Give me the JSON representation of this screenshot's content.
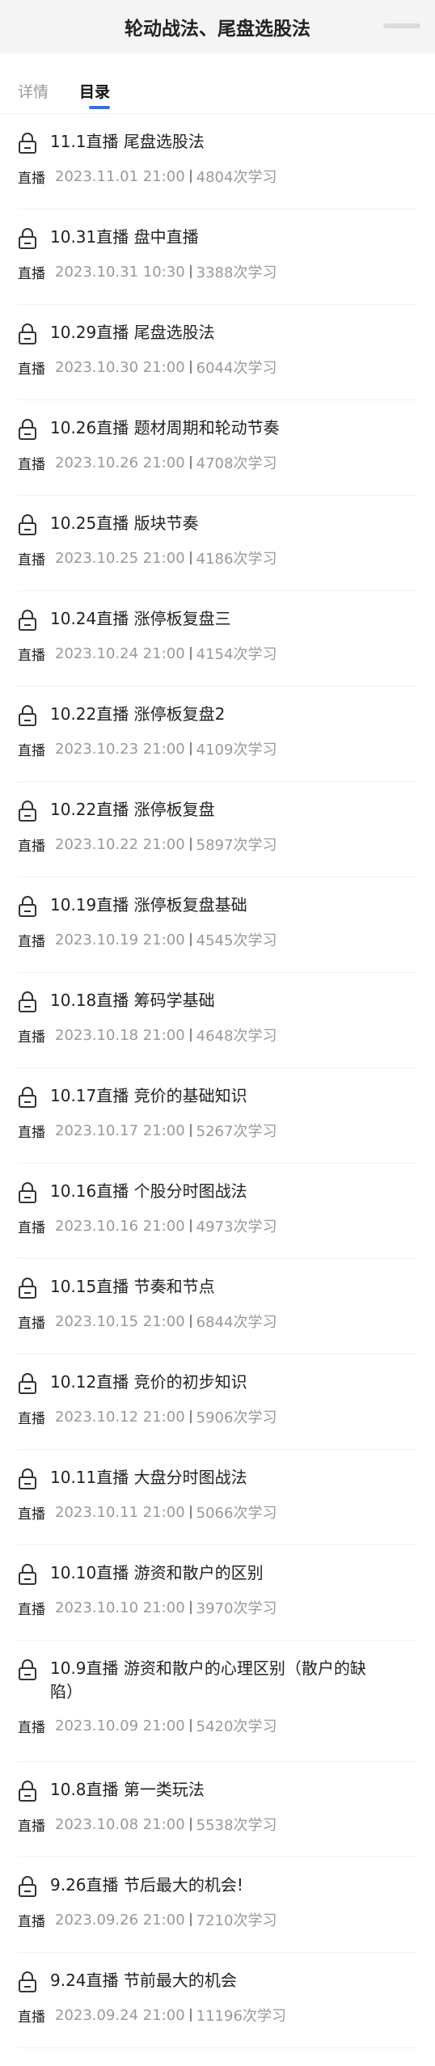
{
  "header": {
    "title": "轮动战法、尾盘选股法"
  },
  "tabs": [
    {
      "label": "详情",
      "active": false
    },
    {
      "label": "目录",
      "active": true
    }
  ],
  "live_label": "直播",
  "items": [
    {
      "title": "11.1直播 尾盘选股法",
      "datetime": "2023.11.01 21:00",
      "views": "4804次学习"
    },
    {
      "title": "10.31直播 盘中直播",
      "datetime": "2023.10.31 10:30",
      "views": "3388次学习"
    },
    {
      "title": "10.29直播 尾盘选股法",
      "datetime": "2023.10.30 21:00",
      "views": "6044次学习"
    },
    {
      "title": "10.26直播 题材周期和轮动节奏",
      "datetime": "2023.10.26 21:00",
      "views": "4708次学习"
    },
    {
      "title": "10.25直播 版块节奏",
      "datetime": "2023.10.25 21:00",
      "views": "4186次学习"
    },
    {
      "title": "10.24直播 涨停板复盘三",
      "datetime": "2023.10.24 21:00",
      "views": "4154次学习"
    },
    {
      "title": "10.22直播 涨停板复盘2",
      "datetime": "2023.10.23 21:00",
      "views": "4109次学习"
    },
    {
      "title": "10.22直播 涨停板复盘",
      "datetime": "2023.10.22 21:00",
      "views": "5897次学习"
    },
    {
      "title": "10.19直播 涨停板复盘基础",
      "datetime": "2023.10.19 21:00",
      "views": "4545次学习"
    },
    {
      "title": "10.18直播 筹码学基础",
      "datetime": "2023.10.18 21:00",
      "views": "4648次学习"
    },
    {
      "title": "10.17直播 竞价的基础知识",
      "datetime": "2023.10.17 21:00",
      "views": "5267次学习"
    },
    {
      "title": "10.16直播 个股分时图战法",
      "datetime": "2023.10.16 21:00",
      "views": "4973次学习"
    },
    {
      "title": "10.15直播 节奏和节点",
      "datetime": "2023.10.15 21:00",
      "views": "6844次学习"
    },
    {
      "title": "10.12直播 竞价的初步知识",
      "datetime": "2023.10.12 21:00",
      "views": "5906次学习"
    },
    {
      "title": "10.11直播 大盘分时图战法",
      "datetime": "2023.10.11 21:00",
      "views": "5066次学习"
    },
    {
      "title": "10.10直播 游资和散户的区别",
      "datetime": "2023.10.10 21:00",
      "views": "3970次学习"
    },
    {
      "title": "10.9直播 游资和散户的心理区别（散户的缺陷）",
      "datetime": "2023.10.09 21:00",
      "views": "5420次学习"
    },
    {
      "title": "10.8直播 第一类玩法",
      "datetime": "2023.10.08 21:00",
      "views": "5538次学习"
    },
    {
      "title": "9.26直播 节后最大的机会!",
      "datetime": "2023.09.26 21:00",
      "views": "7210次学习"
    },
    {
      "title": "9.24直播 节前最大的机会",
      "datetime": "2023.09.24 21:00",
      "views": "11196次学习"
    }
  ]
}
